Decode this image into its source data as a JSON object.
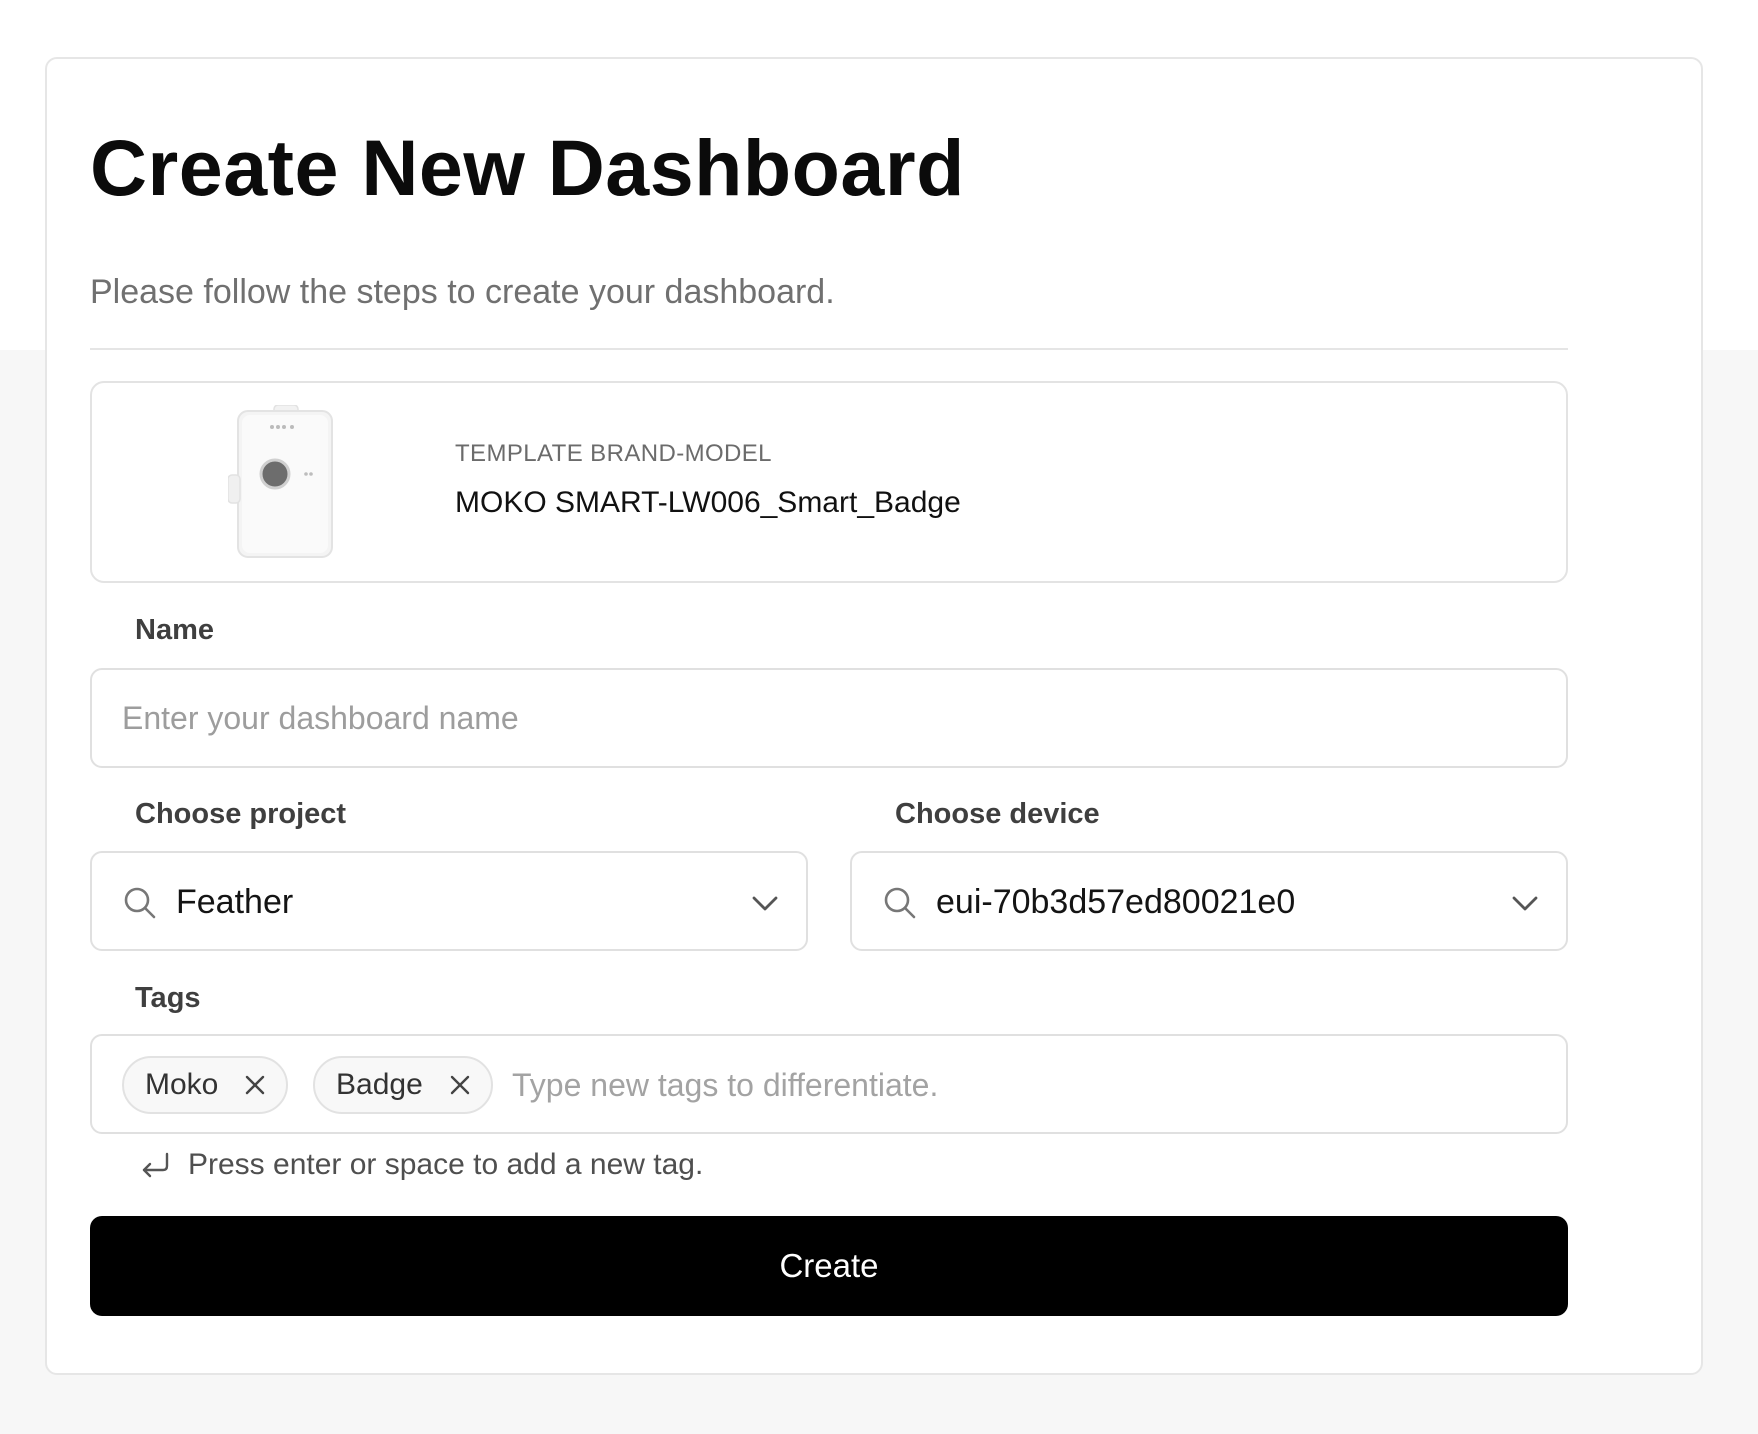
{
  "header": {
    "title": "Create New Dashboard",
    "subtitle": "Please follow the steps to create your dashboard."
  },
  "template": {
    "label": "TEMPLATE BRAND-MODEL",
    "value": "MOKO SMART-LW006_Smart_Badge"
  },
  "name_field": {
    "label": "Name",
    "value": "",
    "placeholder": "Enter your dashboard name"
  },
  "project_field": {
    "label": "Choose project",
    "value": "Feather"
  },
  "device_field": {
    "label": "Choose device",
    "value": "eui-70b3d57ed80021e0"
  },
  "tags_field": {
    "label": "Tags",
    "tags": [
      "Moko",
      "Badge"
    ],
    "placeholder": "Type new tags to differentiate.",
    "hint": "Press enter or space to add a new tag."
  },
  "actions": {
    "create_label": "Create"
  },
  "colors": {
    "page_background": "#f7f7f7",
    "card_background": "#ffffff",
    "primary_button": "#000000",
    "primary_button_text": "#ffffff",
    "border": "#e0e0e0",
    "muted_text": "#707070"
  },
  "icons": {
    "search": "search-icon",
    "chevron": "chevron-down-icon",
    "tag_remove": "close-icon",
    "hint": "enter-icon"
  }
}
